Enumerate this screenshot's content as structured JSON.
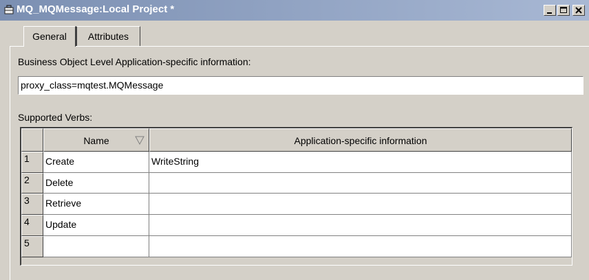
{
  "window": {
    "title": "MQ_MQMessage:Local Project *",
    "icons": {
      "app": "briefcase-icon",
      "minimize": "minimize-icon",
      "maximize": "maximize-icon",
      "close": "close-icon"
    }
  },
  "tabs": [
    {
      "label": "General",
      "active": true
    },
    {
      "label": "Attributes",
      "active": false
    }
  ],
  "general": {
    "bo_info_label": "Business Object Level Application-specific information:",
    "bo_info_value": "proxy_class=mqtest.MQMessage",
    "verbs_label": "Supported Verbs:"
  },
  "verbs_table": {
    "columns": [
      "Name",
      "Application-specific information"
    ],
    "sort_icon": "sort-descending-icon",
    "rows": [
      {
        "num": "1",
        "name": "Create",
        "info": "WriteString"
      },
      {
        "num": "2",
        "name": "Delete",
        "info": ""
      },
      {
        "num": "3",
        "name": "Retrieve",
        "info": ""
      },
      {
        "num": "4",
        "name": "Update",
        "info": ""
      },
      {
        "num": "5",
        "name": "",
        "info": ""
      }
    ]
  },
  "colors": {
    "title_bar": "#7b8fb2",
    "window_bg": "#d4d0c8"
  }
}
